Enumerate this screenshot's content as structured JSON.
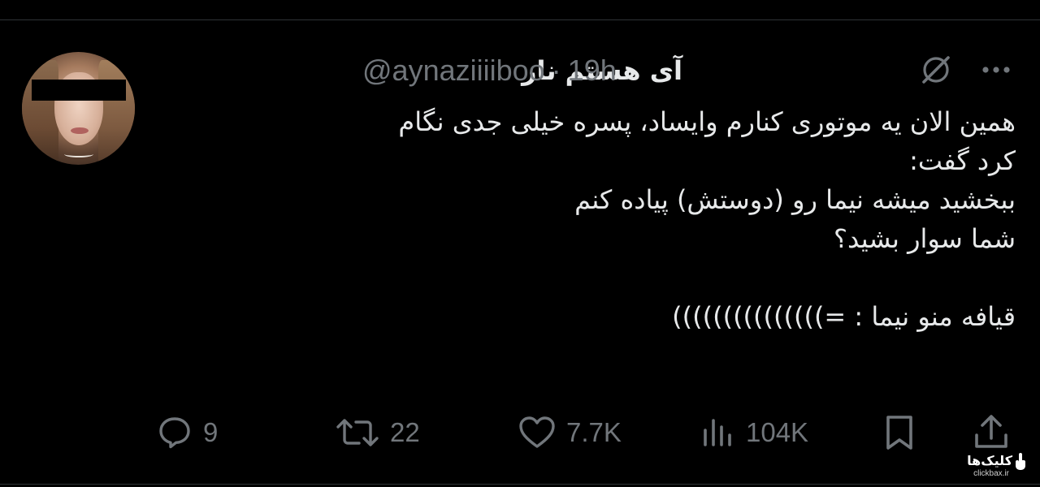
{
  "tweet": {
    "display_name": "آی هستم ناز",
    "handle": "@aynaziiiiboo",
    "separator": "·",
    "time": "19h",
    "text_lines": [
      "همین الان یه موتوری کنارم وایساد، پسره خیلی جدی نگام",
      "کرد گفت:",
      "ببخشید میشه نیما رو (دوستش) پیاده کنم",
      "شما سوار بشید؟",
      "",
      "قیافه منو نیما : =)))))))))))))))"
    ]
  },
  "actions": {
    "reply_count": "9",
    "retweet_count": "22",
    "like_count": "7.7K",
    "views_count": "104K"
  },
  "icons": {
    "avatar": "profile-photo",
    "grok": "grok-icon",
    "more": "more-icon",
    "reply": "reply-icon",
    "retweet": "retweet-icon",
    "like": "heart-icon",
    "views": "views-icon",
    "bookmark": "bookmark-icon",
    "share": "share-icon"
  },
  "watermark": {
    "brand": "کلیک‌ها",
    "url": "clickbax.ir"
  },
  "colors": {
    "background": "#000000",
    "text": "#e7e9ea",
    "muted": "#71767b",
    "divider": "#2f3336"
  }
}
